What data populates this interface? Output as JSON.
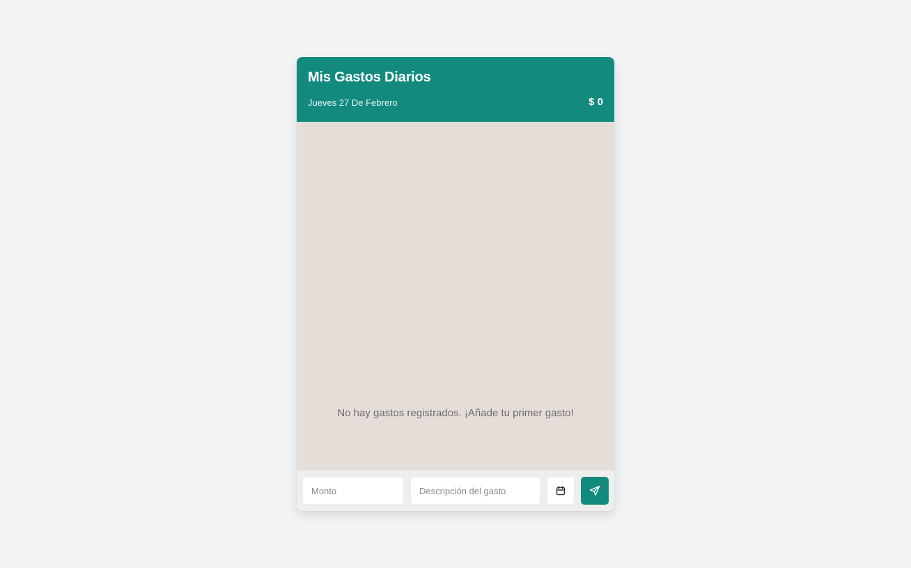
{
  "header": {
    "title": "Mis Gastos Diarios",
    "date": "Jueves 27 De Febrero",
    "total": "$ 0"
  },
  "main": {
    "empty_message": "No hay gastos registrados. ¡Añade tu primer gasto!"
  },
  "form": {
    "amount_placeholder": "Monto",
    "description_placeholder": "Descripción del gasto",
    "calendar_icon": "calendar-icon",
    "send_icon": "send-icon"
  },
  "colors": {
    "accent": "#138a7e",
    "background": "#f2f3f5",
    "chat_background": "#e5ded8"
  }
}
